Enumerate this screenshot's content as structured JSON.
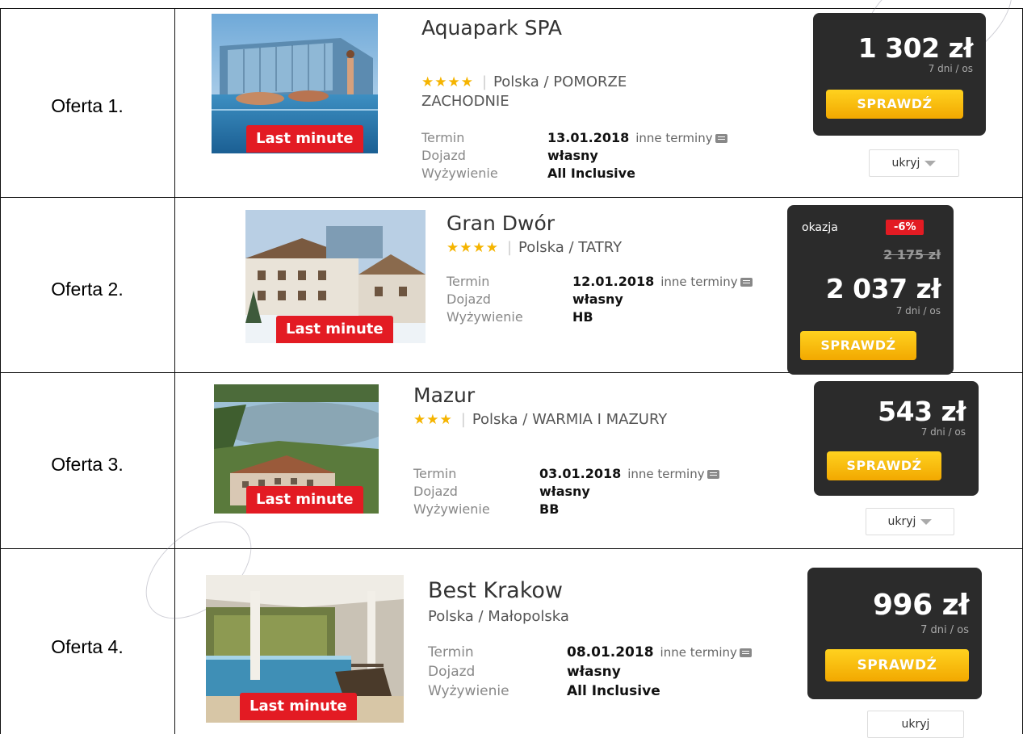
{
  "offers": [
    {
      "label": "Oferta 1.",
      "badge": "Last minute",
      "name": "Aquapark  SPA",
      "stars": "★★★★",
      "location": "Polska / POMORZE ZACHODNIE",
      "termin_label": "Termin",
      "termin": "13.01.2018",
      "more_dates": "inne terminy",
      "dojazd_label": "Dojazd",
      "dojazd": "własny",
      "food_label": "Wyżywienie",
      "food": "All Inclusive",
      "price": "1 302 zł",
      "per": "7 dni / os",
      "button": "SPRAWDŹ",
      "hide": "ukryj"
    },
    {
      "label": "Oferta 2.",
      "badge": "Last minute",
      "name": "Gran Dwór",
      "stars": "★★★★",
      "location": "Polska / TATRY",
      "termin_label": "Termin",
      "termin": "12.01.2018",
      "more_dates": "inne terminy",
      "dojazd_label": "Dojazd",
      "dojazd": "własny",
      "food_label": "Wyżywienie",
      "food": "HB",
      "okazja": "okazja",
      "discount": "-6%",
      "old_price": "2 175 zł",
      "price": "2 037 zł",
      "per": "7 dni / os",
      "button": "SPRAWDŹ"
    },
    {
      "label": "Oferta 3.",
      "badge": "Last minute",
      "name": "Mazur",
      "stars": "★★★",
      "location": "Polska / WARMIA I MAZURY",
      "termin_label": "Termin",
      "termin": "03.01.2018",
      "more_dates": "inne terminy",
      "dojazd_label": "Dojazd",
      "dojazd": "własny",
      "food_label": "Wyżywienie",
      "food": "BB",
      "price": "543 zł",
      "per": "7 dni / os",
      "button": "SPRAWDŹ",
      "hide": "ukryj"
    },
    {
      "label": "Oferta 4.",
      "badge": "Last minute",
      "name": "Best Krakow",
      "location": "Polska / Małopolska",
      "termin_label": "Termin",
      "termin": "08.01.2018",
      "more_dates": "inne terminy",
      "dojazd_label": "Dojazd",
      "dojazd": "własny",
      "food_label": "Wyżywienie",
      "food": "All Inclusive",
      "price": "996 zł",
      "per": "7 dni / os",
      "button": "SPRAWDŹ",
      "hide": "ukryj"
    }
  ],
  "colors": {
    "badge": "#e31b23",
    "price_box": "#2b2b2b",
    "button": "#f5b400",
    "stars": "#f5b400"
  }
}
